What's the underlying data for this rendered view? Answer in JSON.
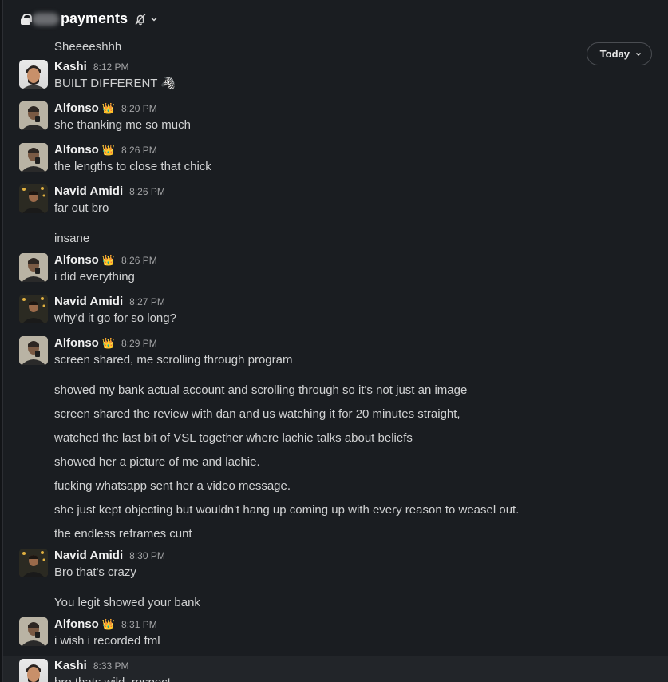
{
  "header": {
    "channel_name": "payments",
    "icons": [
      "lock-icon",
      "bell-off-icon",
      "chevron-down-icon"
    ]
  },
  "date_pill": {
    "label": "Today"
  },
  "colors": {
    "background": "#1a1d21",
    "hover_row": "#222529",
    "text": "#d1d2d3",
    "timestamp": "#a3a4a6"
  },
  "messages": [
    {
      "lines": [
        "Sheeeeshhh"
      ]
    },
    {
      "author": "Kashi",
      "time": "8:12 PM",
      "lines": [
        "BUILT DIFFERENT 🦓"
      ]
    },
    {
      "author": "Alfonso",
      "badge": "👑",
      "time": "8:20 PM",
      "lines": [
        "she thanking me so much"
      ]
    },
    {
      "author": "Alfonso",
      "badge": "👑",
      "time": "8:26 PM",
      "lines": [
        "the lengths to close that chick"
      ]
    },
    {
      "author": "Navid Amidi",
      "time": "8:26 PM",
      "lines": [
        "far out bro"
      ]
    },
    {
      "lines": [
        "insane"
      ]
    },
    {
      "author": "Alfonso",
      "badge": "👑",
      "time": "8:26 PM",
      "lines": [
        "i did everything"
      ]
    },
    {
      "author": "Navid Amidi",
      "time": "8:27 PM",
      "lines": [
        "why'd it go for so long?"
      ]
    },
    {
      "author": "Alfonso",
      "badge": "👑",
      "time": "8:29 PM",
      "lines": [
        "screen shared, me scrolling through program"
      ]
    },
    {
      "lines": [
        "showed my bank actual account and scrolling through so it's not just an image"
      ]
    },
    {
      "lines": [
        "screen shared the review with dan and us watching it for 20 minutes straight,"
      ]
    },
    {
      "lines": [
        "watched the last bit of VSL together where lachie talks about beliefs"
      ]
    },
    {
      "lines": [
        "showed her a picture of me and lachie."
      ]
    },
    {
      "lines": [
        "fucking whatsapp sent her a video message."
      ]
    },
    {
      "lines": [
        "she just kept objecting but wouldn't hang up coming up with every reason to weasel out."
      ]
    },
    {
      "lines": [
        "the endless reframes cunt"
      ]
    },
    {
      "author": "Navid Amidi",
      "time": "8:30 PM",
      "lines": [
        "Bro that's crazy"
      ]
    },
    {
      "lines": [
        "You legit showed your bank"
      ]
    },
    {
      "author": "Alfonso",
      "badge": "👑",
      "time": "8:31 PM",
      "lines": [
        "i wish i recorded fml"
      ]
    },
    {
      "author": "Kashi",
      "time": "8:33 PM",
      "lines": [
        "bro thats wild, respect"
      ]
    }
  ]
}
